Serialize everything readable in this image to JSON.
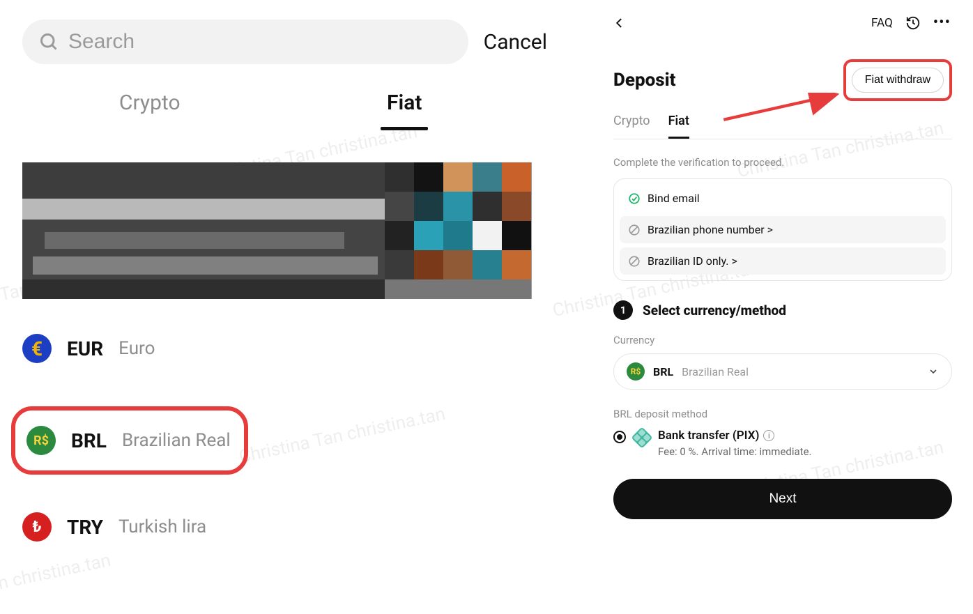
{
  "left": {
    "search_placeholder": "Search",
    "cancel": "Cancel",
    "tabs": {
      "crypto": "Crypto",
      "fiat": "Fiat",
      "active": "fiat"
    },
    "currencies": [
      {
        "code": "EUR",
        "name": "Euro",
        "symbol": "€",
        "icon_bg": "#1b3ec2",
        "highlighted": false
      },
      {
        "code": "BRL",
        "name": "Brazilian Real",
        "symbol": "R$",
        "icon_bg": "#2b8a3e",
        "highlighted": true
      },
      {
        "code": "TRY",
        "name": "Turkish lira",
        "symbol": "₺",
        "icon_bg": "#d62020",
        "highlighted": false
      }
    ]
  },
  "right": {
    "faq": "FAQ",
    "title": "Deposit",
    "fiat_withdraw": "Fiat withdraw",
    "tabs": {
      "crypto": "Crypto",
      "fiat": "Fiat",
      "active": "fiat"
    },
    "verify_hint": "Complete the verification to proceed.",
    "verify_items": {
      "done": "Bind email",
      "pending1": "Brazilian phone number >",
      "pending2": "Brazilian ID only. >"
    },
    "step": {
      "number": "1",
      "title": "Select currency/method"
    },
    "currency_field": {
      "label": "Currency",
      "code": "BRL",
      "name": "Brazilian Real",
      "symbol": "R$"
    },
    "method": {
      "label": "BRL deposit method",
      "name": "Bank transfer (PIX)",
      "sub": "Fee: 0 %. Arrival time: immediate."
    },
    "next": "Next"
  },
  "watermark": "Christina Tan christina.tan"
}
